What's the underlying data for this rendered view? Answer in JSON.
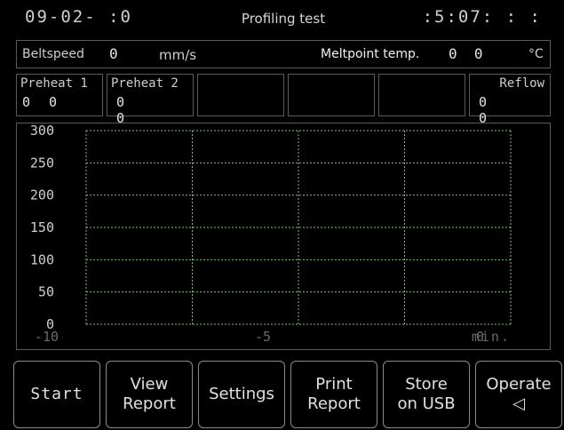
{
  "header": {
    "date": "09-02- :0",
    "title": "Profiling test",
    "time": ":5:07: : :"
  },
  "info_bar": {
    "beltspeed_label": "Beltspeed",
    "beltspeed_value": "0",
    "beltspeed_unit": "mm/s",
    "meltpoint_label": "Meltpoint temp.",
    "meltpoint_value": "0  0",
    "meltpoint_unit": "°C"
  },
  "zones": [
    {
      "name": "Preheat 1",
      "value": "0 0"
    },
    {
      "name": "Preheat 2",
      "value": "0 0"
    },
    {
      "name": "",
      "value": ""
    },
    {
      "name": "",
      "value": ""
    },
    {
      "name": "",
      "value": ""
    },
    {
      "name": "Reflow",
      "value": "0 0"
    }
  ],
  "chart_data": {
    "type": "line",
    "series": [],
    "xlim": [
      -10,
      0
    ],
    "ylim": [
      0,
      300
    ],
    "x_ticks": [
      "-10",
      "-5",
      "0"
    ],
    "x_unit": "min.",
    "y_ticks": [
      "300",
      "250",
      "200",
      "150",
      "100",
      "50",
      "0"
    ],
    "grid": true,
    "grid_style": "dotted",
    "grid_color": "#7fbf7f"
  },
  "buttons": [
    {
      "line1": "Start",
      "line2": ""
    },
    {
      "line1": "View",
      "line2": "Report"
    },
    {
      "line1": "Settings",
      "line2": ""
    },
    {
      "line1": "Print",
      "line2": "Report"
    },
    {
      "line1": "Store",
      "line2": "on USB"
    },
    {
      "line1": "Operate",
      "line2": "◁"
    }
  ]
}
